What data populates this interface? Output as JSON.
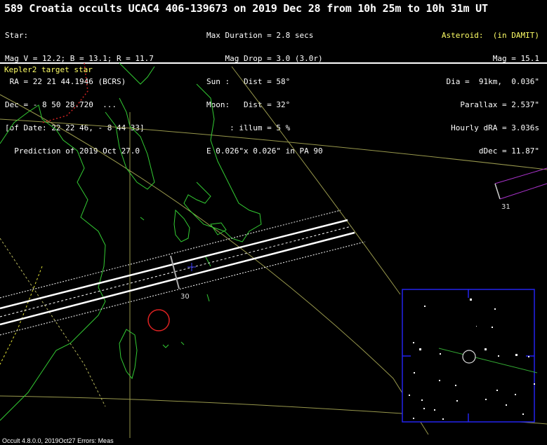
{
  "header": {
    "title": "589 Croatia occults UCAC4 406-139673 on 2019 Dec 28 from 10h 25m to 10h 31m UT",
    "left": [
      "Star:",
      "Mag V = 12.2; B = 13.1; R = 11.7",
      " RA = 22 21 44.1946 (BCRS)",
      "Dec = - 8 50 28.720  ...",
      "[of Date: 22 22 46, - 8 44 33]",
      "  Prediction of 2019 Oct 27.0"
    ],
    "middle": [
      "Max Duration = 2.8 secs",
      "    Mag Drop = 3.0 (3.0r)",
      "Sun :   Dist = 58°",
      "Moon:   Dist = 32°",
      "     : illum = 5 %",
      "E 0.026\"x 0.026\" in PA 90"
    ],
    "right_head": "Asteroid:  (in DAMIT)",
    "right": [
      "Mag = 15.1",
      "Dia =  91km,  0.036\"",
      "Parallax = 2.537\"",
      "Hourly dRA = 3.036s",
      "dDec = 11.87\""
    ]
  },
  "map": {
    "kepler_label": "Kepler2 target star",
    "tick_30": "30",
    "tick_31": "31"
  },
  "footer": "Occult 4.8.0.0, 2019Oct27  Errors: Meas",
  "colors": {
    "background": "#000000",
    "coastline": "#33cc33",
    "graticule": "#b3b35a",
    "path_line": "#ffffff",
    "inset_border": "#2222ee",
    "site_circle": "#dd2222",
    "accent_text": "#ffff66",
    "border_red": "#cc2222",
    "plus_marker": "#4444ff",
    "side_path": "#aa33cc"
  },
  "icons": [
    "plus-marker-icon",
    "red-circle-icon",
    "asteroid-circle-icon"
  ]
}
